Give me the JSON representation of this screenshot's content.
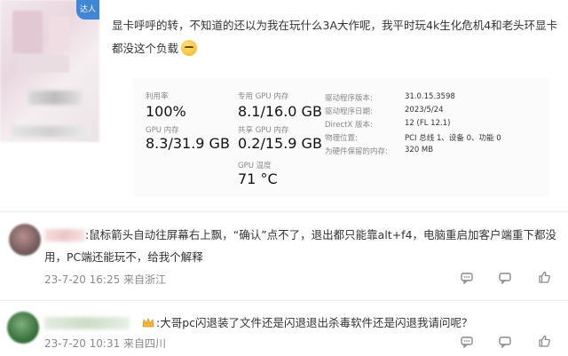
{
  "post": {
    "badge": "达人",
    "text": "显卡呼呼的转，不知道的还以为我在玩什么3A大作呢，我平时玩4k生化危机4和老头环显卡都没这个负载"
  },
  "gpu_panel": {
    "util_label": "利用率",
    "util_value": "100%",
    "gpu_mem_label": "GPU 内存",
    "gpu_mem_value": "8.3/31.9 GB",
    "dedicated_label": "专用 GPU 内存",
    "dedicated_value": "8.1/16.0 GB",
    "shared_label": "共享 GPU 内存",
    "shared_value": "0.2/15.9 GB",
    "temp_label": "GPU 温度",
    "temp_value": "71 °C",
    "rows": [
      {
        "label": "驱动程序版本:",
        "value": "31.0.15.3598"
      },
      {
        "label": "驱动程序日期:",
        "value": "2023/5/24"
      },
      {
        "label": "DirectX 版本:",
        "value": "12 (FL 12.1)"
      },
      {
        "label": "物理位置:",
        "value": "PCI 总线 1、设备 0、功能 0"
      },
      {
        "label": "为硬件保留的内存:",
        "value": "320 MB"
      }
    ]
  },
  "comments": [
    {
      "text": ":鼠标箭头自动往屏幕右上飘，“确认”点不了，退出都只能靠alt+f4，电脑重启加客户端重下都没用，PC端还能玩不，给我个解释",
      "meta": "23-7-20 16:25 来自浙江"
    },
    {
      "text": ":大哥pc闪退装了文件还是闪退退出杀毒软件还是闪退我请问呢？",
      "meta": "23-7-20 10:31 来自四川"
    }
  ]
}
